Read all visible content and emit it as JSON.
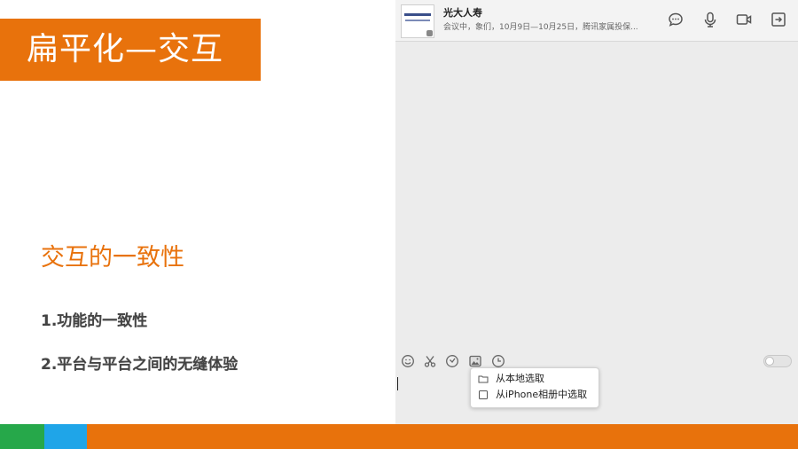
{
  "slide": {
    "title": "扁平化—交互",
    "subheading": "交互的一致性",
    "points": [
      "1.功能的一致性",
      "2.平台与平台之间的无缝体验"
    ]
  },
  "chat": {
    "contact_name": "光大人寿",
    "last_message": "会议中，象们，10月9日—10月25日，腾讯家属投保...",
    "header_icons": [
      "chat-bubble-icon",
      "microphone-icon",
      "video-camera-icon",
      "share-exit-icon"
    ],
    "toolbar_icons": [
      "emoji-icon",
      "scissors-icon",
      "shake-icon",
      "image-icon",
      "clock-icon"
    ],
    "image_menu": {
      "items": [
        {
          "icon": "folder-icon",
          "label": "从本地选取"
        },
        {
          "icon": "checkbox-icon",
          "label": "从iPhone相册中选取"
        }
      ]
    }
  },
  "colors": {
    "accent_orange": "#e8720c",
    "strip_green": "#26a84a",
    "strip_blue": "#1fa5e8"
  }
}
